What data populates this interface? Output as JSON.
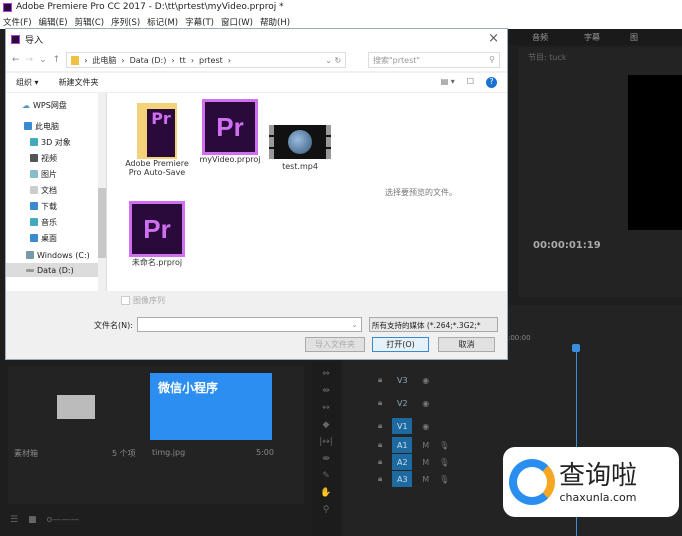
{
  "app": {
    "title": "Adobe Premiere Pro CC 2017 - D:\\tt\\prtest\\myVideo.prproj *",
    "menu": [
      "文件(F)",
      "编辑(E)",
      "剪辑(C)",
      "序列(S)",
      "标记(M)",
      "字幕(T)",
      "窗口(W)",
      "帮助(H)"
    ]
  },
  "right_panel": {
    "tabs": [
      "音频",
      "字幕",
      "图"
    ],
    "program_label": "节目: tuck",
    "timecode": "00:00:01:19",
    "ruler_start": ":00:00"
  },
  "dialog": {
    "title": "导入",
    "close": "×",
    "breadcrumb": [
      "此电脑",
      "Data (D:)",
      "tt",
      "prtest"
    ],
    "search_placeholder": "搜索\"prtest\"",
    "toolbar": {
      "organize": "组织 ▾",
      "new_folder": "新建文件夹"
    },
    "sidebar": [
      "WPS网盘",
      "此电脑",
      "3D 对象",
      "视频",
      "图片",
      "文档",
      "下载",
      "音乐",
      "桌面",
      "Windows (C:)",
      "Data (D:)"
    ],
    "files": [
      {
        "name": "Adobe Premiere Pro Auto-Save",
        "type": "folder"
      },
      {
        "name": "myVideo.prproj",
        "type": "prproj"
      },
      {
        "name": "test.mp4",
        "type": "video"
      },
      {
        "name": "未命名.prproj",
        "type": "prproj"
      }
    ],
    "preview_hint": "选择要预览的文件。",
    "image_sequence": "图像序列",
    "filename_label": "文件名(N):",
    "filename_value": "",
    "filter": "所有支持的媒体 (*.264;*.3G2;*",
    "buttons": {
      "import_folder": "导入文件夹",
      "open": "打开(O)",
      "cancel": "取消"
    }
  },
  "project": {
    "bin_name": "素材箱",
    "bin_count": "5 个项",
    "clip_name": "timg.jpg",
    "clip_duration": "5:00",
    "thumb_text": "微信小程序"
  },
  "tracks": [
    "V3",
    "V2",
    "V1",
    "A1",
    "A2",
    "A3"
  ],
  "watermark": {
    "brand": "查询啦",
    "url": "chaxunla.com"
  }
}
